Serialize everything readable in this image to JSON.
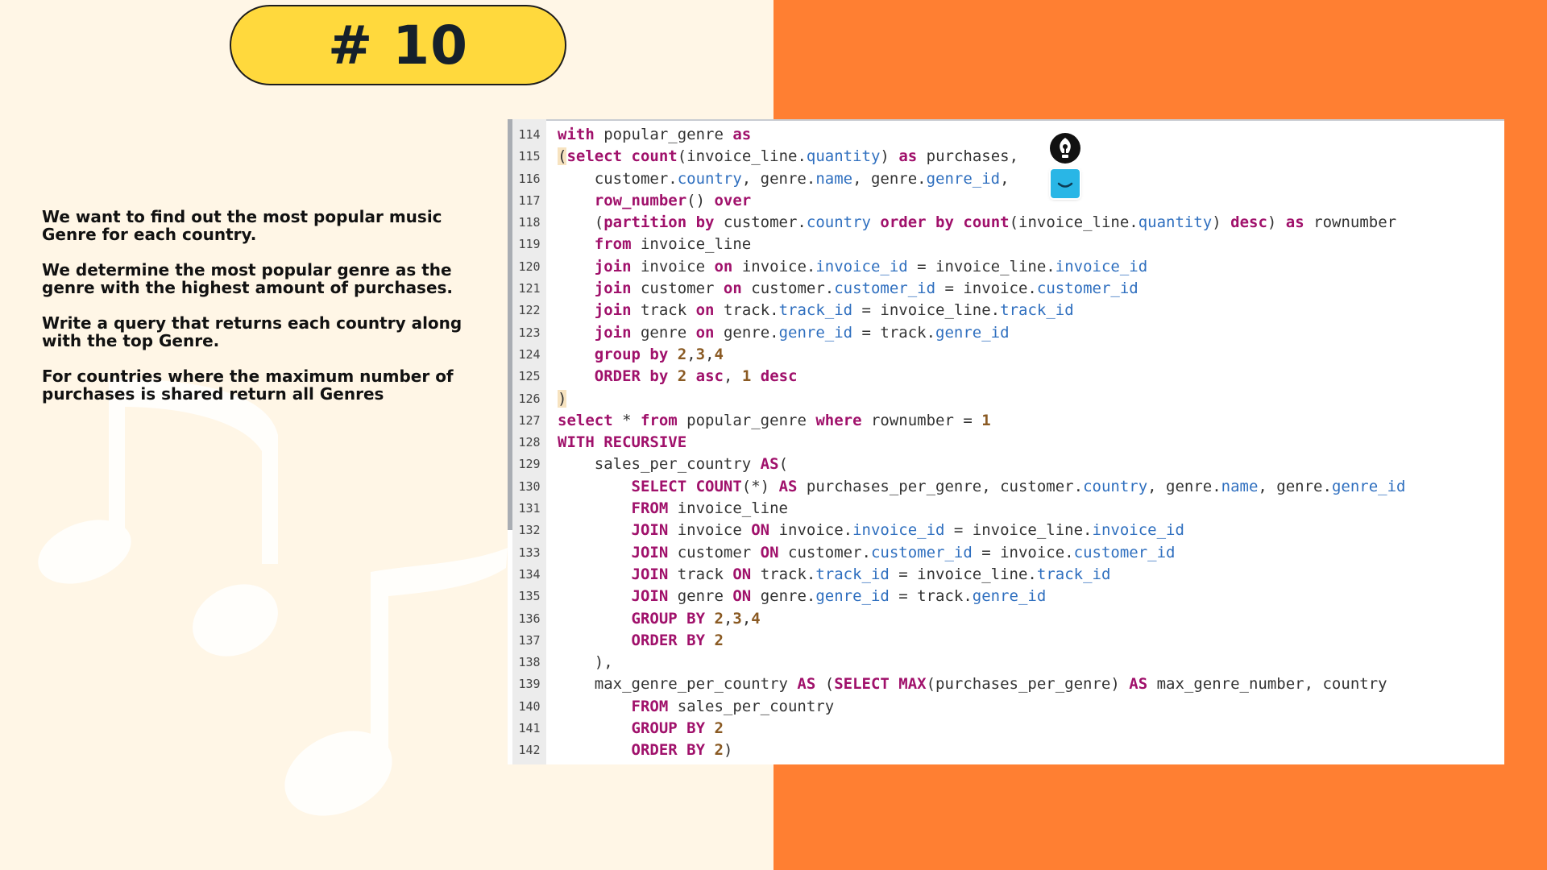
{
  "slide": {
    "title": "# 10",
    "instructions": [
      "We want to find out the most popular music Genre for each country.",
      "We determine the most popular genre as the genre with the highest amount of purchases.",
      "Write a query that returns each country along with the top Genre.",
      "For countries where the maximum number of purchases is shared return all Genres"
    ]
  },
  "colors": {
    "background": "#fff6e6",
    "orange_panel": "#ff7f32",
    "title_pill": "#ffd93d",
    "keyword": "#a0116b",
    "column": "#2f6fbf",
    "number": "#8a5a23"
  },
  "icons": [
    "pen-nib-icon",
    "chat-bubble-icon",
    "music-note-icon"
  ],
  "editor": {
    "lines": [
      {
        "n": "114",
        "tokens": [
          [
            "k",
            "with"
          ],
          [
            "t",
            " popular_genre "
          ],
          [
            "k",
            "as"
          ]
        ]
      },
      {
        "n": "115",
        "tokens": [
          [
            "h",
            "("
          ],
          [
            "k",
            "select"
          ],
          [
            "t",
            " "
          ],
          [
            "k",
            "count"
          ],
          [
            "t",
            "(invoice_line."
          ],
          [
            "c",
            "quantity"
          ],
          [
            "t",
            ") "
          ],
          [
            "k",
            "as"
          ],
          [
            "t",
            " purchases,"
          ]
        ]
      },
      {
        "n": "116",
        "tokens": [
          [
            "t",
            "    customer."
          ],
          [
            "c",
            "country"
          ],
          [
            "t",
            ", genre."
          ],
          [
            "c",
            "name"
          ],
          [
            "t",
            ", genre."
          ],
          [
            "c",
            "genre_id"
          ],
          [
            "t",
            ","
          ]
        ]
      },
      {
        "n": "117",
        "tokens": [
          [
            "t",
            "    "
          ],
          [
            "k",
            "row_number"
          ],
          [
            "t",
            "() "
          ],
          [
            "k",
            "over"
          ]
        ]
      },
      {
        "n": "118",
        "tokens": [
          [
            "t",
            "    ("
          ],
          [
            "k",
            "partition by"
          ],
          [
            "t",
            " customer."
          ],
          [
            "c",
            "country"
          ],
          [
            "t",
            " "
          ],
          [
            "k",
            "order by"
          ],
          [
            "t",
            " "
          ],
          [
            "k",
            "count"
          ],
          [
            "t",
            "(invoice_line."
          ],
          [
            "c",
            "quantity"
          ],
          [
            "t",
            ") "
          ],
          [
            "k",
            "desc"
          ],
          [
            "t",
            ") "
          ],
          [
            "k",
            "as"
          ],
          [
            "t",
            " rownumber"
          ]
        ]
      },
      {
        "n": "119",
        "tokens": [
          [
            "t",
            "    "
          ],
          [
            "k",
            "from"
          ],
          [
            "t",
            " invoice_line"
          ]
        ]
      },
      {
        "n": "120",
        "tokens": [
          [
            "t",
            "    "
          ],
          [
            "k",
            "join"
          ],
          [
            "t",
            " invoice "
          ],
          [
            "k",
            "on"
          ],
          [
            "t",
            " invoice."
          ],
          [
            "c",
            "invoice_id"
          ],
          [
            "t",
            " = invoice_line."
          ],
          [
            "c",
            "invoice_id"
          ]
        ]
      },
      {
        "n": "121",
        "tokens": [
          [
            "t",
            "    "
          ],
          [
            "k",
            "join"
          ],
          [
            "t",
            " customer "
          ],
          [
            "k",
            "on"
          ],
          [
            "t",
            " customer."
          ],
          [
            "c",
            "customer_id"
          ],
          [
            "t",
            " = invoice."
          ],
          [
            "c",
            "customer_id"
          ]
        ]
      },
      {
        "n": "122",
        "tokens": [
          [
            "t",
            "    "
          ],
          [
            "k",
            "join"
          ],
          [
            "t",
            " track "
          ],
          [
            "k",
            "on"
          ],
          [
            "t",
            " track."
          ],
          [
            "c",
            "track_id"
          ],
          [
            "t",
            " = invoice_line."
          ],
          [
            "c",
            "track_id"
          ]
        ]
      },
      {
        "n": "123",
        "tokens": [
          [
            "t",
            "    "
          ],
          [
            "k",
            "join"
          ],
          [
            "t",
            " genre "
          ],
          [
            "k",
            "on"
          ],
          [
            "t",
            " genre."
          ],
          [
            "c",
            "genre_id"
          ],
          [
            "t",
            " = track."
          ],
          [
            "c",
            "genre_id"
          ]
        ]
      },
      {
        "n": "124",
        "tokens": [
          [
            "t",
            "    "
          ],
          [
            "k",
            "group by"
          ],
          [
            "t",
            " "
          ],
          [
            "n",
            "2"
          ],
          [
            "t",
            ","
          ],
          [
            "n",
            "3"
          ],
          [
            "t",
            ","
          ],
          [
            "n",
            "4"
          ]
        ]
      },
      {
        "n": "125",
        "tokens": [
          [
            "t",
            "    "
          ],
          [
            "k",
            "ORDER by"
          ],
          [
            "t",
            " "
          ],
          [
            "n",
            "2"
          ],
          [
            "t",
            " "
          ],
          [
            "k",
            "asc"
          ],
          [
            "t",
            ", "
          ],
          [
            "n",
            "1"
          ],
          [
            "t",
            " "
          ],
          [
            "k",
            "desc"
          ]
        ]
      },
      {
        "n": "126",
        "tokens": [
          [
            "h",
            ")"
          ]
        ]
      },
      {
        "n": "127",
        "tokens": [
          [
            "k",
            "select"
          ],
          [
            "t",
            " * "
          ],
          [
            "k",
            "from"
          ],
          [
            "t",
            " popular_genre "
          ],
          [
            "k",
            "where"
          ],
          [
            "t",
            " rownumber = "
          ],
          [
            "n",
            "1"
          ]
        ]
      },
      {
        "n": "128",
        "tokens": [
          [
            "k",
            "WITH RECURSIVE"
          ]
        ]
      },
      {
        "n": "129",
        "tokens": [
          [
            "t",
            "    sales_per_country "
          ],
          [
            "k",
            "AS"
          ],
          [
            "t",
            "("
          ]
        ]
      },
      {
        "n": "130",
        "tokens": [
          [
            "t",
            "        "
          ],
          [
            "k",
            "SELECT COUNT"
          ],
          [
            "t",
            "(*) "
          ],
          [
            "k",
            "AS"
          ],
          [
            "t",
            " purchases_per_genre, customer."
          ],
          [
            "c",
            "country"
          ],
          [
            "t",
            ", genre."
          ],
          [
            "c",
            "name"
          ],
          [
            "t",
            ", genre."
          ],
          [
            "c",
            "genre_id"
          ]
        ]
      },
      {
        "n": "131",
        "tokens": [
          [
            "t",
            "        "
          ],
          [
            "k",
            "FROM"
          ],
          [
            "t",
            " invoice_line"
          ]
        ]
      },
      {
        "n": "132",
        "tokens": [
          [
            "t",
            "        "
          ],
          [
            "k",
            "JOIN"
          ],
          [
            "t",
            " invoice "
          ],
          [
            "k",
            "ON"
          ],
          [
            "t",
            " invoice."
          ],
          [
            "c",
            "invoice_id"
          ],
          [
            "t",
            " = invoice_line."
          ],
          [
            "c",
            "invoice_id"
          ]
        ]
      },
      {
        "n": "133",
        "tokens": [
          [
            "t",
            "        "
          ],
          [
            "k",
            "JOIN"
          ],
          [
            "t",
            " customer "
          ],
          [
            "k",
            "ON"
          ],
          [
            "t",
            " customer."
          ],
          [
            "c",
            "customer_id"
          ],
          [
            "t",
            " = invoice."
          ],
          [
            "c",
            "customer_id"
          ]
        ]
      },
      {
        "n": "134",
        "tokens": [
          [
            "t",
            "        "
          ],
          [
            "k",
            "JOIN"
          ],
          [
            "t",
            " track "
          ],
          [
            "k",
            "ON"
          ],
          [
            "t",
            " track."
          ],
          [
            "c",
            "track_id"
          ],
          [
            "t",
            " = invoice_line."
          ],
          [
            "c",
            "track_id"
          ]
        ]
      },
      {
        "n": "135",
        "tokens": [
          [
            "t",
            "        "
          ],
          [
            "k",
            "JOIN"
          ],
          [
            "t",
            " genre "
          ],
          [
            "k",
            "ON"
          ],
          [
            "t",
            " genre."
          ],
          [
            "c",
            "genre_id"
          ],
          [
            "t",
            " = track."
          ],
          [
            "c",
            "genre_id"
          ]
        ]
      },
      {
        "n": "136",
        "tokens": [
          [
            "t",
            "        "
          ],
          [
            "k",
            "GROUP BY"
          ],
          [
            "t",
            " "
          ],
          [
            "n",
            "2"
          ],
          [
            "t",
            ","
          ],
          [
            "n",
            "3"
          ],
          [
            "t",
            ","
          ],
          [
            "n",
            "4"
          ]
        ]
      },
      {
        "n": "137",
        "tokens": [
          [
            "t",
            "        "
          ],
          [
            "k",
            "ORDER BY"
          ],
          [
            "t",
            " "
          ],
          [
            "n",
            "2"
          ]
        ]
      },
      {
        "n": "138",
        "tokens": [
          [
            "t",
            "    ),"
          ]
        ]
      },
      {
        "n": "139",
        "tokens": [
          [
            "t",
            "    max_genre_per_country "
          ],
          [
            "k",
            "AS"
          ],
          [
            "t",
            " ("
          ],
          [
            "k",
            "SELECT MAX"
          ],
          [
            "t",
            "(purchases_per_genre) "
          ],
          [
            "k",
            "AS"
          ],
          [
            "t",
            " max_genre_number, country"
          ]
        ]
      },
      {
        "n": "140",
        "tokens": [
          [
            "t",
            "        "
          ],
          [
            "k",
            "FROM"
          ],
          [
            "t",
            " sales_per_country"
          ]
        ]
      },
      {
        "n": "141",
        "tokens": [
          [
            "t",
            "        "
          ],
          [
            "k",
            "GROUP BY"
          ],
          [
            "t",
            " "
          ],
          [
            "n",
            "2"
          ]
        ]
      },
      {
        "n": "142",
        "tokens": [
          [
            "t",
            "        "
          ],
          [
            "k",
            "ORDER BY"
          ],
          [
            "t",
            " "
          ],
          [
            "n",
            "2"
          ],
          [
            "t",
            ")"
          ]
        ]
      }
    ]
  }
}
